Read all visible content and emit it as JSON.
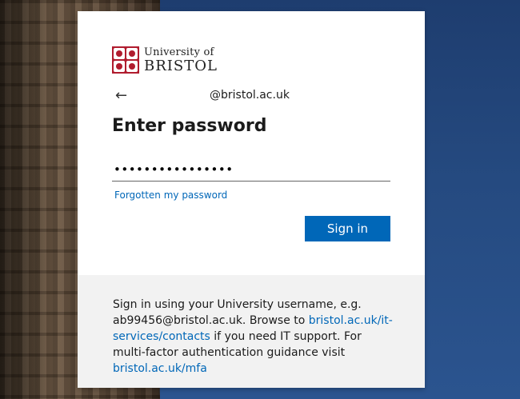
{
  "login": {
    "logo": {
      "line1": "University of",
      "line2": "BRISTOL"
    },
    "identity": "@bristol.ac.uk",
    "title": "Enter password",
    "password_value": "••••••••••••••••",
    "forgot_link": "Forgotten my password",
    "signin_label": "Sign in"
  },
  "footer": {
    "text_1": "Sign in using your University username, e.g. ab99456@bristol.ac.uk. Browse to ",
    "link_1": "bristol.ac.uk/it-services/contacts",
    "text_2": " if you need IT support. For multi-factor authentication guidance visit ",
    "link_2": "bristol.ac.uk/mfa"
  },
  "colors": {
    "accent": "#0067b8",
    "crest": "#b01c2e",
    "footer_bg": "#f2f2f2"
  },
  "icons": {
    "back": "back-arrow-icon",
    "crest": "university-crest-icon"
  }
}
